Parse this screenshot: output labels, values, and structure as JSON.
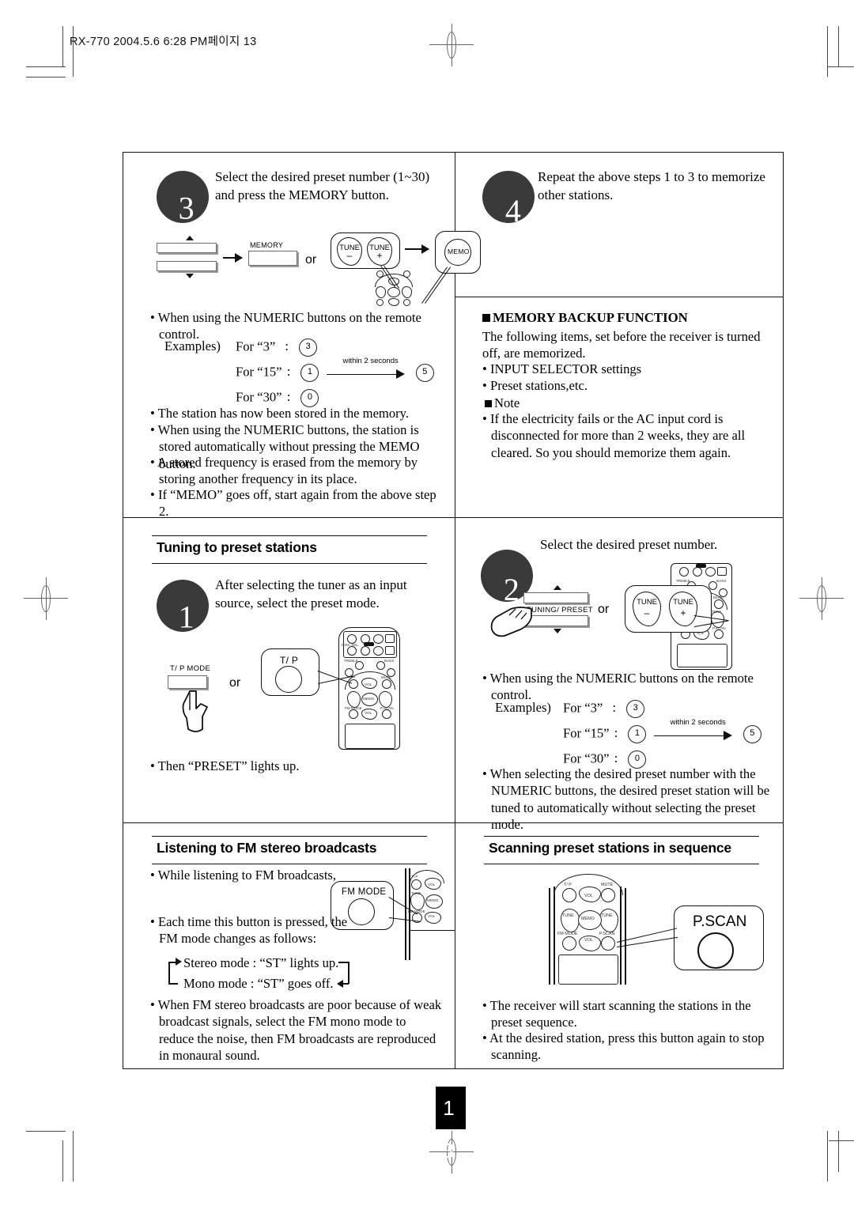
{
  "header": {
    "slug": "RX-770  2004.5.6  6:28 PM페이지 13"
  },
  "page": {
    "number": "1 3"
  },
  "panels": {
    "step3": {
      "number": "3",
      "instruction": "Select the desired preset number (1~30) and press the MEMORY button.",
      "diagram": {
        "memory_label": "MEMORY",
        "or_label": "or",
        "tune_minus": {
          "top": "TUNE",
          "sign": "–"
        },
        "tune_plus": {
          "top": "TUNE",
          "sign": "+"
        },
        "memo_label": "MEMO"
      },
      "bullets": [
        "When using the NUMERIC buttons on the remote control.",
        "The station has now been stored in the memory.",
        "When using the NUMERIC buttons, the station is stored automatically without pressing the MEMO button.",
        "A stored frequency is erased from the memory by storing another frequency in its place.",
        "If “MEMO” goes off, start again from the above step 2."
      ],
      "examples": {
        "label": "Examples)",
        "rows": [
          {
            "text": "For “3”",
            "colon": ":",
            "keys": [
              "3"
            ]
          },
          {
            "text": "For “15”",
            "colon": ":",
            "keys": [
              "1",
              "5"
            ],
            "between": "within 2 seconds"
          },
          {
            "text": "For “30”",
            "colon": ":",
            "keys": [
              "0"
            ]
          }
        ]
      }
    },
    "step4": {
      "number": "4",
      "instruction": "Repeat the above steps 1 to 3 to memorize other stations."
    },
    "memory_backup": {
      "heading": "MEMORY BACKUP FUNCTION",
      "intro": "The following items, set before the receiver is turned off, are memorized.",
      "items": [
        "INPUT SELECTOR settings",
        "Preset stations,etc."
      ],
      "note_heading": "Note",
      "note_text": "If the electricity fails or the AC input cord is disconnected for more than 2 weeks, they are all cleared. So you should memorize them again."
    },
    "tuning_preset": {
      "heading": "Tuning to preset stations",
      "step": {
        "number": "1",
        "instruction": "After selecting the tuner as an input source, select the preset mode."
      },
      "diagram": {
        "tp_mode_label": "T/ P MODE",
        "or_label": "or",
        "tp_callout": "T/ P"
      },
      "bullets": [
        "Then “PRESET” lights up."
      ]
    },
    "select_preset": {
      "step": {
        "number": "2",
        "instruction": "Select the desired preset number."
      },
      "diagram": {
        "tuning_preset_label": "TUNING/ PRESET",
        "or_label": "or",
        "tune_minus": {
          "top": "TUNE",
          "sign": "–"
        },
        "tune_plus": {
          "top": "TUNE",
          "sign": "+"
        }
      },
      "bullets": [
        "When using the NUMERIC buttons on the remote control.",
        "When selecting the desired preset number with the NUMERIC buttons, the desired preset station will be tuned to automatically without selecting the preset mode."
      ],
      "examples": {
        "label": "Examples)",
        "rows": [
          {
            "text": "For “3”",
            "colon": ":",
            "keys": [
              "3"
            ]
          },
          {
            "text": "For “15”",
            "colon": ":",
            "keys": [
              "1",
              "5"
            ],
            "between": "within 2 seconds"
          },
          {
            "text": "For “30”",
            "colon": ":",
            "keys": [
              "0"
            ]
          }
        ]
      }
    },
    "fm_stereo": {
      "heading": "Listening to FM stereo broadcasts",
      "bullets": [
        "While listening to FM broadcasts,",
        "Each time this button is pressed, the FM mode changes as follows:",
        "When FM stereo broadcasts are poor because of weak broadcast signals, select the FM mono mode to reduce the noise, then FM broadcasts are reproduced in monaural sound."
      ],
      "callout": "FM MODE",
      "modes": [
        "Stereo mode : “ST” lights up.",
        "Mono mode : “ST” goes off."
      ]
    },
    "p_scan": {
      "heading": "Scanning preset stations in sequence",
      "callout": "P.SCAN",
      "bullets": [
        "The receiver will start scanning the stations in the preset sequence.",
        "At the desired station, press this button again to stop scanning."
      ]
    }
  },
  "remote_keys": {
    "tp": "T/ P",
    "mute": "MUTE",
    "vol_up": "VOL",
    "vol_down": "VOL",
    "tune_minus": "TUNE",
    "tune_plus": "TUNE",
    "memo": "MEMO",
    "fm_mode": "FM MODE",
    "p_scan": "P.SCAN",
    "treble": "TREBLE",
    "bass": "BASS"
  },
  "colors": {
    "ink": "#111111",
    "bubble": "#3a3a3a",
    "panel_gray": "#6d6d6d",
    "page_bg": "#ffffff"
  }
}
